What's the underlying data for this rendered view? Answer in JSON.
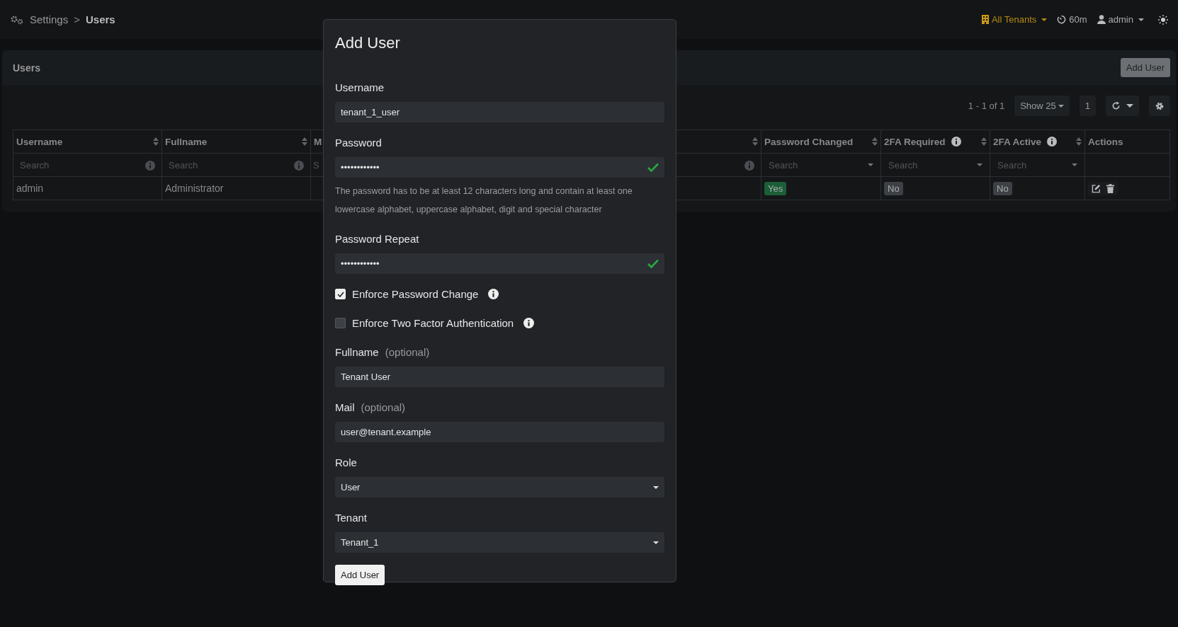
{
  "topbar": {
    "breadcrumb": [
      {
        "label": "Settings",
        "current": false
      },
      {
        "label": "Users",
        "current": true
      }
    ],
    "separator": ">",
    "tenant_menu": "All Tenants",
    "timer": "60m",
    "user_menu": "admin"
  },
  "users_panel": {
    "title": "Users",
    "add_button": "Add User",
    "range": "1 - 1 of 1",
    "page_size": "Show 25",
    "page": "1",
    "table": {
      "columns": [
        {
          "label": "Username",
          "sortable": true,
          "info": false,
          "filter": {
            "kind": "text",
            "placeholder": "Search",
            "info": true
          }
        },
        {
          "label": "Fullname",
          "sortable": true,
          "info": false,
          "filter": {
            "kind": "text",
            "placeholder": "Search",
            "info": true
          }
        },
        {
          "label": "M",
          "filter": {
            "kind": "text",
            "placeholder": "S"
          }
        },
        {
          "sortable": true,
          "filter": {
            "kind": "text",
            "info": true
          }
        },
        {
          "label": "Password Changed",
          "sortable": true,
          "info": false,
          "filter": {
            "kind": "select",
            "placeholder": "Search"
          }
        },
        {
          "label": "2FA Required",
          "sortable": true,
          "info": true,
          "filter": {
            "kind": "select",
            "placeholder": "Search"
          }
        },
        {
          "label": "2FA Active",
          "sortable": true,
          "info": true,
          "filter": {
            "kind": "select",
            "placeholder": "Search"
          }
        },
        {
          "label": "Actions",
          "sortable": false,
          "info": false
        }
      ],
      "rows": [
        {
          "cells": [
            {
              "kind": "text",
              "text": "admin"
            },
            {
              "kind": "text",
              "text": "Administrator"
            },
            {
              "kind": "covered"
            },
            {
              "kind": "covered"
            },
            {
              "kind": "badge",
              "text": "Yes",
              "color": "#1b5e38"
            },
            {
              "kind": "badge",
              "text": "No",
              "color": "#3d4045"
            },
            {
              "kind": "badge",
              "text": "No",
              "color": "#3d4045"
            },
            {
              "kind": "actions"
            }
          ]
        }
      ]
    }
  },
  "dialog": {
    "title": "Add User",
    "fields": [
      {
        "kind": "text",
        "label": "Username",
        "value": "tenant_1_user"
      },
      {
        "kind": "password",
        "label": "Password",
        "value": "••••••••••••",
        "valid": true,
        "hint": "The password has to be at least 12 characters long and contain at least one lowercase alphabet, uppercase alphabet, digit and special character"
      },
      {
        "kind": "password",
        "label": "Password Repeat",
        "value": "••••••••••••",
        "valid": true
      },
      {
        "kind": "checkbox",
        "label": "Enforce Password Change",
        "checked": true,
        "info": true
      },
      {
        "kind": "checkbox",
        "label": "Enforce Two Factor Authentication",
        "checked": false,
        "info": true
      },
      {
        "kind": "text",
        "label": "Fullname",
        "note": "(optional)",
        "value": "Tenant User"
      },
      {
        "kind": "text",
        "label": "Mail",
        "note": "(optional)",
        "value": "user@tenant.example"
      },
      {
        "kind": "select",
        "label": "Role",
        "value": "User"
      },
      {
        "kind": "select",
        "label": "Tenant",
        "value": "Tenant_1"
      }
    ],
    "submit": "Add User"
  }
}
